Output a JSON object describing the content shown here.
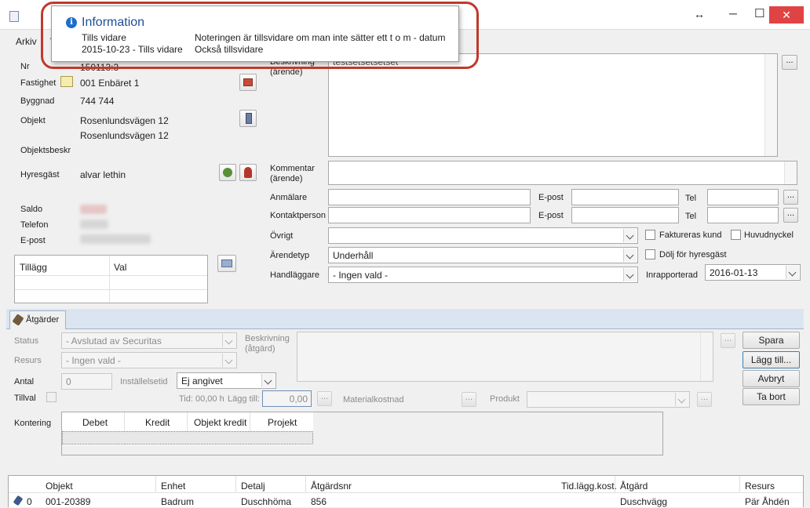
{
  "window": {
    "resize_glyph": "↔",
    "min_glyph": "─",
    "max_glyph": "☐",
    "close_glyph": "✕",
    "close_color": "#e04343"
  },
  "menu": {
    "items": [
      "Arkiv",
      "V"
    ]
  },
  "tooltip": {
    "title": "Information",
    "rows": [
      {
        "left": "Tills vidare",
        "right": "Noteringen är tillsvidare om man inte sätter ett t o m - datum"
      },
      {
        "left": "2015-10-23 - Tills vidare",
        "right": "Också tillsvidare"
      }
    ]
  },
  "left_panel": {
    "nr_label": "Nr",
    "nr_value": "150113:3",
    "fastighet_label": "Fastighet",
    "fastighet_value": "001 Enbäret 1",
    "byggnad_label": "Byggnad",
    "byggnad_value": "744 744",
    "objekt_label": "Objekt",
    "objekt_value1": "Rosenlundsvägen 12",
    "objekt_value2": "Rosenlundsvägen 12",
    "objektsbeskr_label": "Objektsbeskr",
    "hyresgast_label": "Hyresgäst",
    "hyresgast_value": "alvar lethin",
    "saldo_label": "Saldo",
    "telefon_label": "Telefon",
    "epost_label": "E-post"
  },
  "tillagg": {
    "col1": "Tillägg",
    "col2": "Val"
  },
  "right_panel": {
    "beskrivning_label": "Beskrivning (ärende)",
    "beskrivning_value": "testsetsetsetset",
    "kommentar_label": "Kommentar (ärende)",
    "anmalare_label": "Anmälare",
    "kontaktperson_label": "Kontaktperson",
    "epost_label": "E-post",
    "tel_label": "Tel",
    "ovrigt_label": "Övrigt",
    "arendetyp_label": "Ärendetyp",
    "arendetyp_value": "Underhåll",
    "handlaggare_label": "Handläggare",
    "handlaggare_value": "- Ingen vald -",
    "faktureras_label": "Faktureras kund",
    "huvudnyckel_label": "Huvudnyckel",
    "dolj_label": "Dölj för hyresgäst",
    "inrapporterad_label": "Inrapporterad",
    "inrapporterad_value": "2016-01-13"
  },
  "atgarder": {
    "tab_label": "Åtgärder",
    "status_label": "Status",
    "status_value": "- Avslutad av Securitas",
    "resurs_label": "Resurs",
    "resurs_value": "- Ingen vald -",
    "antal_label": "Antal",
    "antal_value": "0",
    "installelsetid_label": "Inställelsetid",
    "installelsetid_value": "Ej angivet",
    "tillval_label": "Tillval",
    "tid_label": "Tid: 00,00 h",
    "lagg_till_label": "Lägg till:",
    "lagg_till_value": "0,00",
    "materialkostnad_label": "Materialkostnad",
    "produkt_label": "Produkt",
    "beskrivning_label": "Beskrivning (åtgärd)",
    "spara": "Spara",
    "lagg_till_btn": "Lägg till...",
    "avbryt": "Avbryt",
    "ta_bort": "Ta bort",
    "kontering_label": "Kontering",
    "kontering_cols": [
      "Debet",
      "Kredit",
      "Objekt kredit",
      "Projekt"
    ]
  },
  "table": {
    "headers": [
      "Objekt",
      "Enhet",
      "Detalj",
      "Åtgärdsnr",
      "Tid.lägg.kost.",
      "Åtgärd",
      "Resurs"
    ],
    "row": {
      "index": "0",
      "objekt": "001-20389",
      "enhet": "Badrum",
      "detalj": "Duschhöma",
      "atgardsnr": "856",
      "tid": "",
      "atgard": "Duschvägg",
      "resurs": "Pär Åhdén"
    }
  }
}
